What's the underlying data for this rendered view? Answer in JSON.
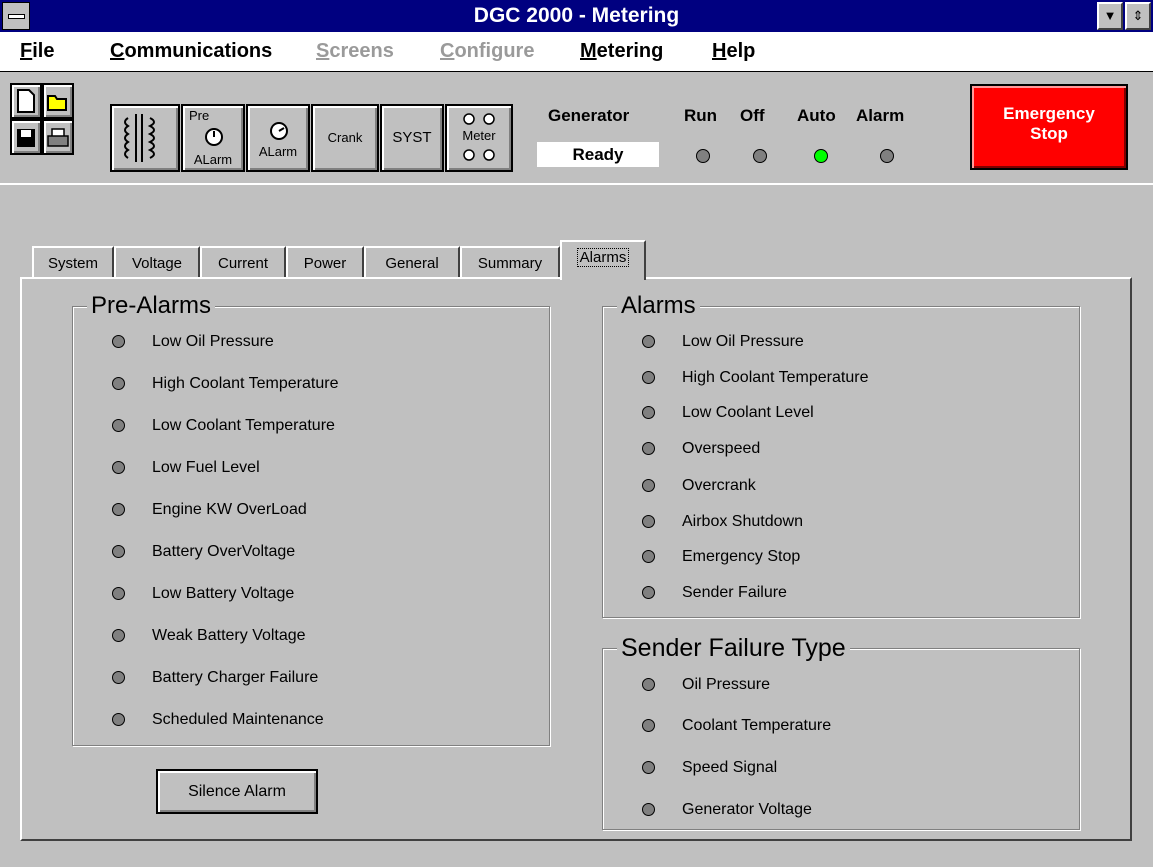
{
  "window": {
    "title": "DGC 2000 - Metering"
  },
  "menu": [
    {
      "label": "File",
      "enabled": true
    },
    {
      "label": "Communications",
      "enabled": true
    },
    {
      "label": "Screens",
      "enabled": false
    },
    {
      "label": "Configure",
      "enabled": false
    },
    {
      "label": "Metering",
      "enabled": true
    },
    {
      "label": "Help",
      "enabled": true
    }
  ],
  "toolbar": {
    "pre_alarm": [
      "Pre",
      "ALarm"
    ],
    "alarm": "ALarm",
    "crank": "Crank",
    "syst": "SYST",
    "meter": "Meter"
  },
  "status": {
    "generator_label": "Generator",
    "generator_state": "Ready",
    "indicators": [
      {
        "label": "Run",
        "on": false
      },
      {
        "label": "Off",
        "on": false
      },
      {
        "label": "Auto",
        "on": true
      },
      {
        "label": "Alarm",
        "on": false
      }
    ],
    "emergency_stop": [
      "Emergency",
      "Stop"
    ]
  },
  "tabs": [
    "System",
    "Voltage",
    "Current",
    "Power",
    "General",
    "Summary",
    "Alarms"
  ],
  "active_tab": "Alarms",
  "pre_alarms": {
    "title": "Pre-Alarms",
    "items": [
      "Low Oil Pressure",
      "High Coolant Temperature",
      "Low Coolant Temperature",
      "Low Fuel Level",
      "Engine KW OverLoad",
      "Battery OverVoltage",
      "Low Battery Voltage",
      "Weak Battery Voltage",
      "Battery Charger Failure",
      "Scheduled Maintenance"
    ]
  },
  "alarms": {
    "title": "Alarms",
    "items": [
      "Low Oil Pressure",
      "High Coolant Temperature",
      "Low Coolant Level",
      "Overspeed",
      "Overcrank",
      "Airbox Shutdown",
      "Emergency Stop",
      "Sender Failure"
    ]
  },
  "sender_failure": {
    "title": "Sender Failure Type",
    "items": [
      "Oil Pressure",
      "Coolant Temperature",
      "Speed Signal",
      "Generator Voltage"
    ]
  },
  "silence_button": "Silence Alarm",
  "colors": {
    "title_bar": "#000080",
    "face": "#c0c0c0",
    "estop": "#ff0000",
    "led_on": "#00ff00",
    "led_off": "#808080"
  }
}
